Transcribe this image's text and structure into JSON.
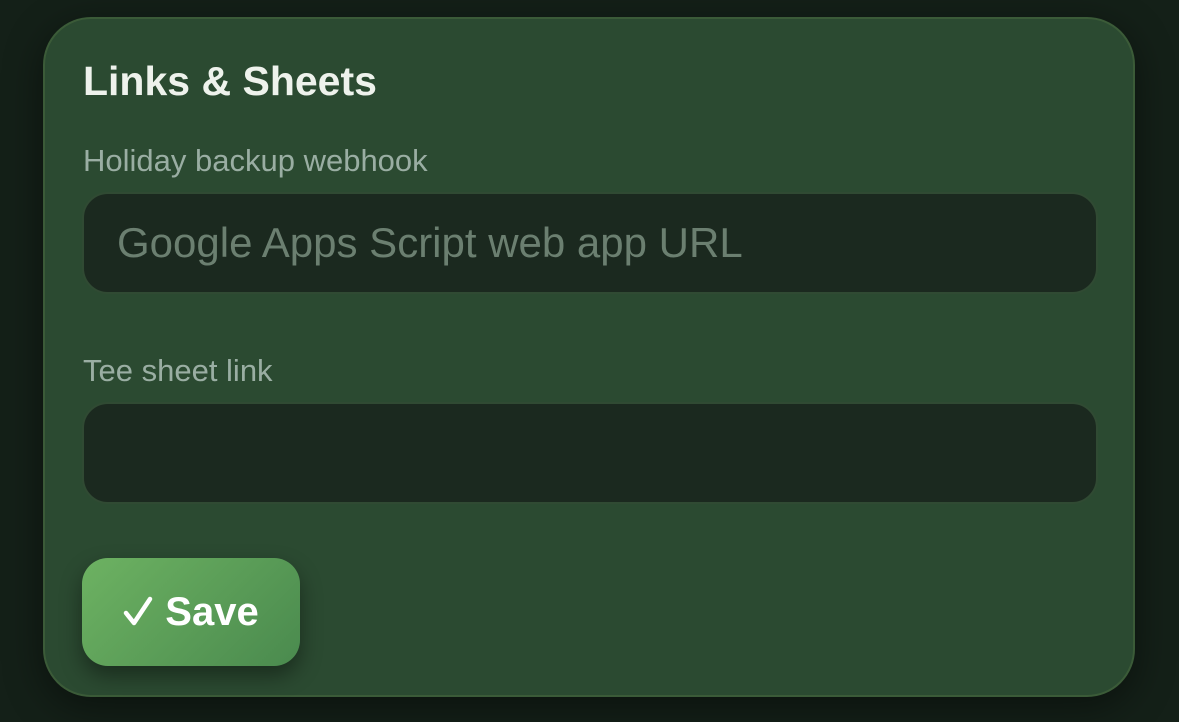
{
  "card": {
    "title": "Links & Sheets"
  },
  "fields": {
    "webhook": {
      "label": "Holiday backup webhook",
      "value": "",
      "placeholder": "Google Apps Script web app URL"
    },
    "tee_sheet": {
      "label": "Tee sheet link",
      "value": "",
      "placeholder": ""
    }
  },
  "actions": {
    "save_label": "Save",
    "save_icon": "check-icon"
  },
  "colors": {
    "page_background": "#142018",
    "card_background": "#2b4a31",
    "input_background": "#1b291f",
    "accent": "#5c9e58",
    "title_text": "#eef2ec",
    "label_text": "#9aaea3",
    "placeholder_text": "#6b7f70"
  }
}
